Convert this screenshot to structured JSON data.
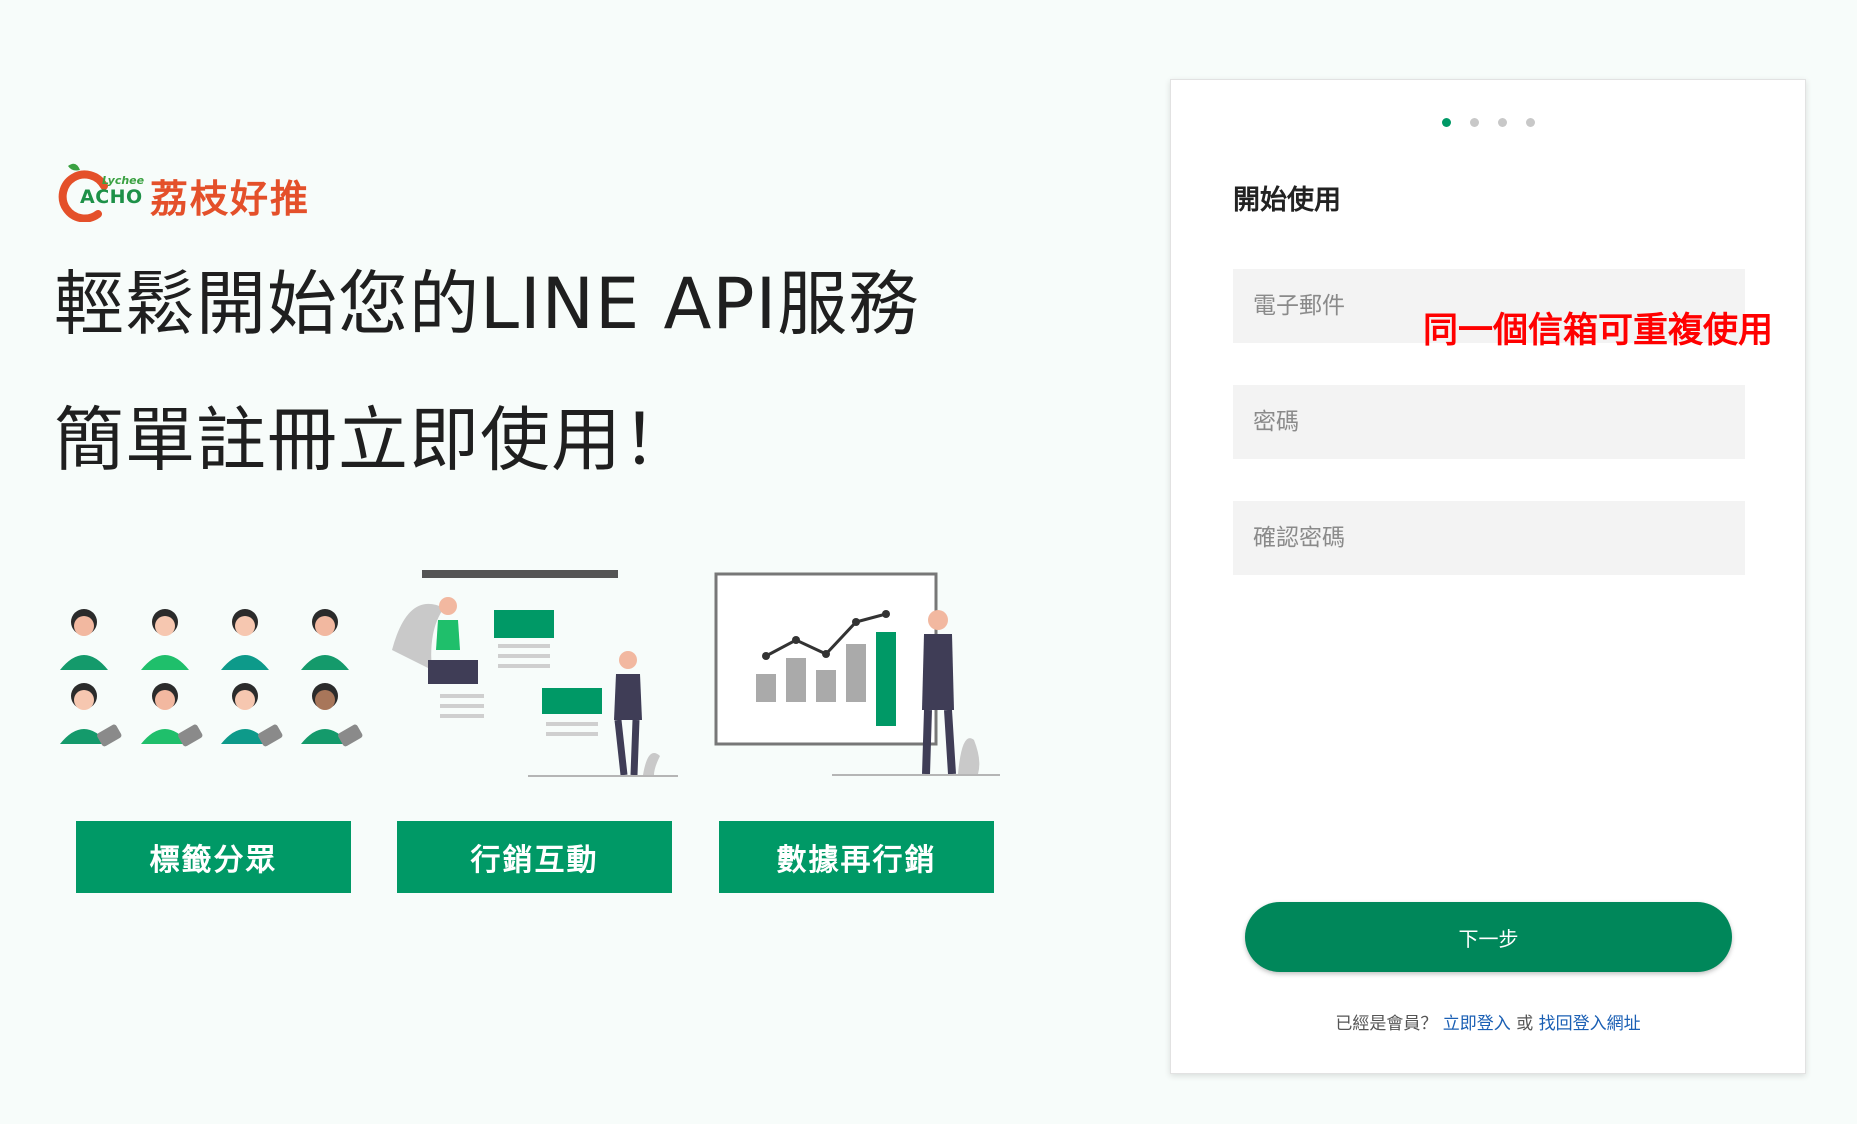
{
  "logo": {
    "small_text": "Lychee",
    "acho": "ACHO",
    "name": "荔枝好推"
  },
  "headline": {
    "line1": "輕鬆開始您的LINE API服務",
    "line2": "簡單註冊立即使用！"
  },
  "features": [
    {
      "label": "標籤分眾"
    },
    {
      "label": "行銷互動"
    },
    {
      "label": "數據再行銷"
    }
  ],
  "signup": {
    "step_count": 4,
    "active_step": 1,
    "title": "開始使用",
    "email_placeholder": "電子郵件",
    "password_placeholder": "密碼",
    "confirm_placeholder": "確認密碼",
    "annotation": "同一個信箱可重複使用",
    "next_label": "下一步",
    "already_member": "已經是會員？",
    "login_link": "立即登入",
    "or_text": "或",
    "recover_link": "找回登入網址"
  },
  "colors": {
    "brand_green": "#009966",
    "annotation_red": "#ff0000",
    "logo_red": "#e4502a"
  }
}
